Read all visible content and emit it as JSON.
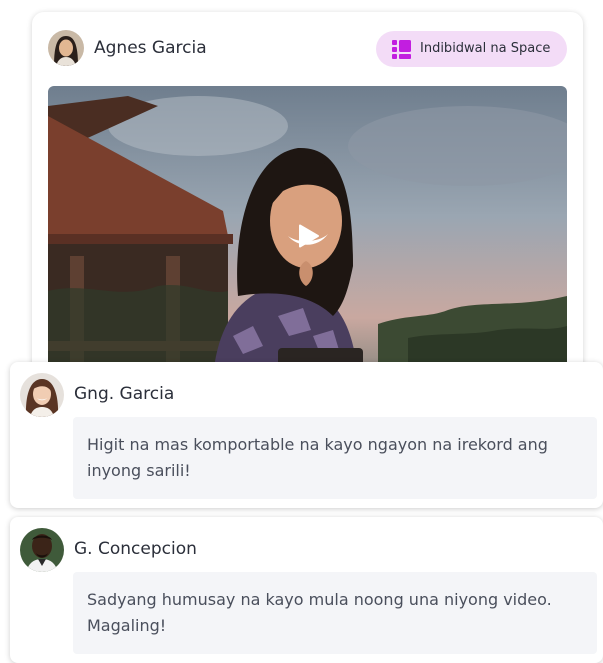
{
  "post": {
    "author_name": "Agnes Garcia",
    "space_badge_label": "Indibidwal na Space",
    "icons": {
      "badge": "space-grid-icon",
      "play": "play-icon"
    },
    "colors": {
      "badge_bg": "#f3dcf7",
      "badge_icon": "#c21ee0"
    }
  },
  "comments": [
    {
      "name": "Gng. Garcia",
      "text": "Higit na mas komportable na kayo ngayon na irekord ang inyong sarili!"
    },
    {
      "name": "G. Concepcion",
      "text": "Sadyang humusay na kayo mula noong una niyong video. Magaling!"
    }
  ]
}
